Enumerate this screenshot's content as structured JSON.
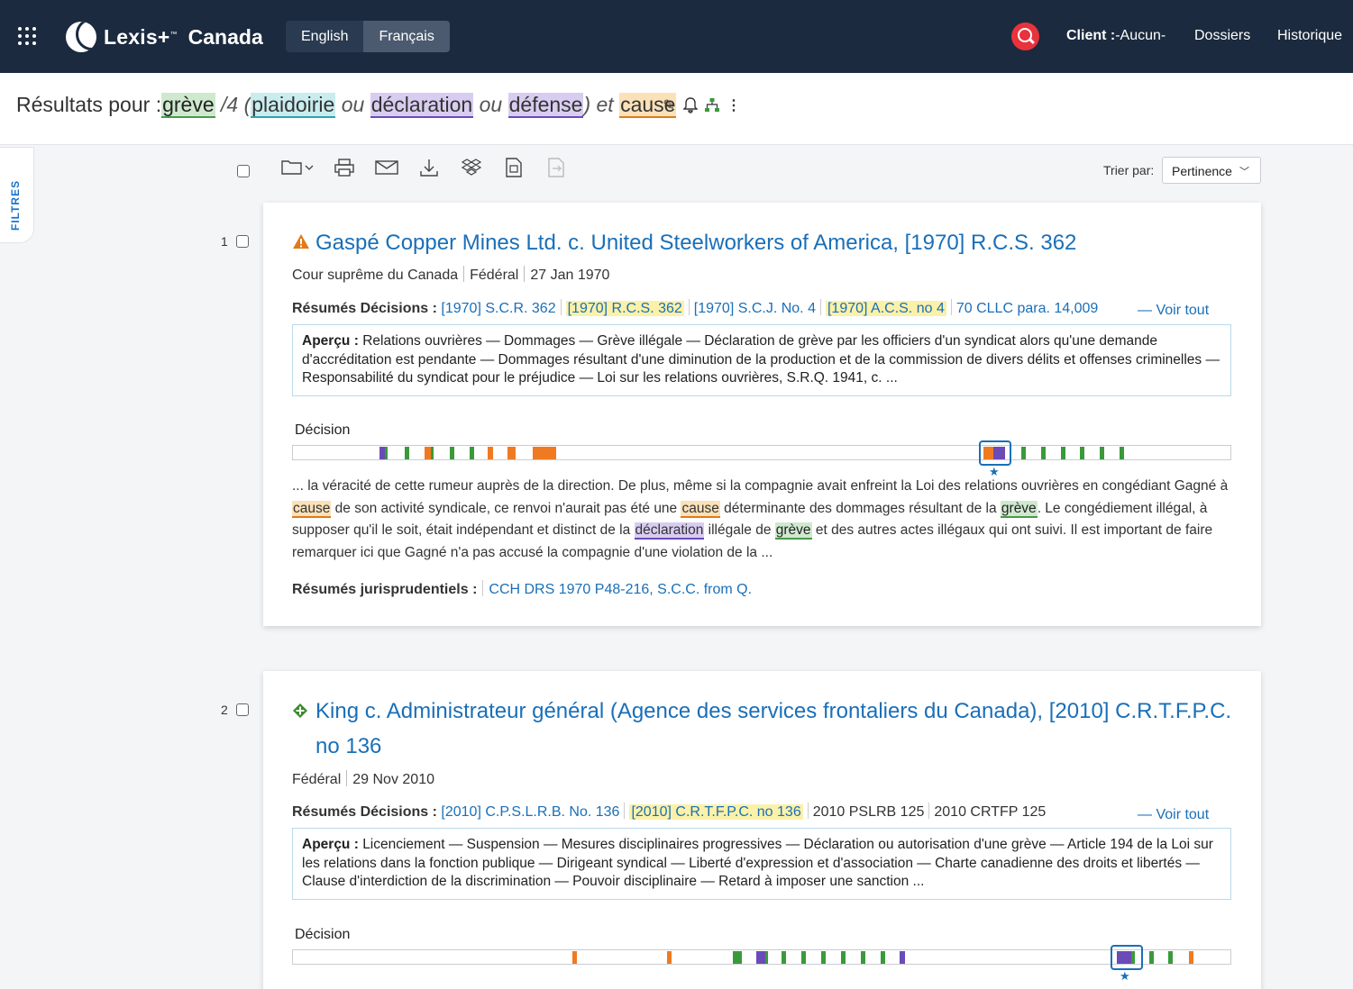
{
  "nav": {
    "brand": "Lexis+",
    "brand_tm": "™",
    "country": "Canada",
    "lang_english": "English",
    "lang_french": "Français",
    "client_label": "Client :",
    "client_value": "-Aucun-",
    "dossiers": "Dossiers",
    "historique": "Historique"
  },
  "query": {
    "prefix": "Résultats pour :",
    "t1": "grève",
    "t2": " /4 (",
    "t3": "plaidoirie",
    "t4": " ou ",
    "t5": "déclaration",
    "t6": " ou ",
    "t7": "défense",
    "t8": ") et ",
    "t9": "cause"
  },
  "filters_label": "FILTRES",
  "sort": {
    "label": "Trier par:",
    "value": "Pertinence"
  },
  "results": [
    {
      "number": "1",
      "title": "Gaspé Copper Mines Ltd. c. United Steelworkers of America, [1970] R.C.S. 362",
      "court": "Cour suprême du Canada",
      "jurisdiction": "Fédéral",
      "date": "27 Jan 1970",
      "cites_label": "Résumés Décisions :",
      "cites": [
        "[1970] S.C.R. 362",
        "[1970] R.C.S. 362",
        "[1970] S.C.J. No. 4",
        "[1970] A.C.S. no 4",
        "70 CLLC para. 14,009"
      ],
      "voir_tout": "— Voir tout",
      "apercu_label": "Aperçu :",
      "apercu": "Relations ouvrières — Dommages — Grève illégale — Déclaration de grève par les officiers d'un syndicat alors qu'une demande d'accréditation est pendante — Dommages résultant d'une diminution de la production et de la commission de divers délits et offenses criminelles — Responsabilité du syndicat pour le préjudice — Loi sur les relations ouvrières, S.R.Q. 1941, c. ...",
      "decision_label": "Décision",
      "snippet": {
        "a": "... la véracité de cette rumeur auprès de la direction. De plus, même si la compagnie avait enfreint la Loi des relations ouvrières en congédiant Gagné à ",
        "h1": "cause",
        "b": " de son activité syndicale, ce renvoi n'aurait pas été une ",
        "h2": "cause",
        "c": " déterminante des dommages résultant de la ",
        "h3": "grève",
        "d": ". Le congédiement illégal, à supposer qu'il le soit, était indépendant et distinct de la ",
        "h4": "déclaration",
        "e": " illégale de ",
        "h5": "grève",
        "f": " et des autres actes illégaux qui ont suivi. Il est important de faire remarquer ici que Gagné n'a pas accusé la compagnie d'une violation de la ..."
      },
      "resumes_label": "Résumés jurisprudentiels :",
      "resumes_link": "CCH DRS 1970 P48-216, S.C.C. from Q."
    },
    {
      "number": "2",
      "title": "King c. Administrateur général (Agence des services frontaliers du Canada), [2010] C.R.T.F.P.C. no 136",
      "jurisdiction": "Fédéral",
      "date": "29 Nov 2010",
      "cites_label": "Résumés Décisions :",
      "cites": [
        "[2010] C.P.S.L.R.B. No. 136",
        "[2010] C.R.T.F.P.C. no 136",
        "2010 PSLRB 125",
        "2010 CRTFP 125"
      ],
      "voir_tout": "— Voir tout",
      "apercu_label": "Aperçu :",
      "apercu": "Licenciement — Suspension — Mesures disciplinaires progressives — Déclaration ou autorisation d'une grève — Article 194 de la Loi sur les relations dans la fonction publique — Dirigeant syndical — Liberté d'expression et d'association — Charte canadienne des droits et libertés — Clause d'interdiction de la discrimination — Pouvoir disciplinaire — Retard à imposer une sanction ...",
      "decision_label": "Décision"
    }
  ],
  "colors": {
    "navbar": "#1b2a3e",
    "link": "#1a6fb8",
    "search": "#e8333c"
  }
}
